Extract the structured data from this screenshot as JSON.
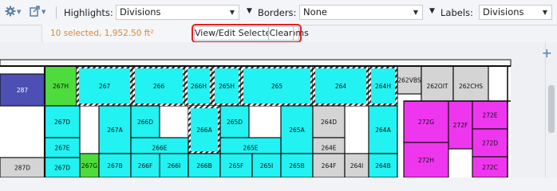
{
  "toolbar": {
    "highlights_label": "Highlights:",
    "highlights_value": "Divisions",
    "borders_label": "Borders:",
    "borders_value": "None",
    "labels_label": "Labels:",
    "labels_value": "Divisions"
  },
  "selection": {
    "count_text": "10 selected, 1,952.50 ft²",
    "view_edit_label": "View/Edit Selected Rooms",
    "clear_label": "Clear"
  },
  "colors": {
    "cyan": "#22f2f2",
    "green": "#4ddc3c",
    "magenta": "#ef36ef",
    "navy": "#4e4fb5",
    "gray": "#d4d4d4",
    "wall": "#111111"
  },
  "rooms": [
    {
      "label": "287",
      "color": "navy"
    },
    {
      "label": "267H",
      "color": "green"
    },
    {
      "label": "267",
      "color": "cyan",
      "selected": true
    },
    {
      "label": "266",
      "color": "cyan",
      "selected": true
    },
    {
      "label": "266H",
      "color": "cyan",
      "selected": true
    },
    {
      "label": "265H",
      "color": "cyan",
      "selected": true
    },
    {
      "label": "265",
      "color": "cyan",
      "selected": true
    },
    {
      "label": "264",
      "color": "cyan",
      "selected": true
    },
    {
      "label": "264H",
      "color": "cyan",
      "selected": true
    },
    {
      "label": "262VBS",
      "color": "gray"
    },
    {
      "label": "262OIT",
      "color": "gray"
    },
    {
      "label": "262CHS",
      "color": "gray"
    },
    {
      "label": "267D",
      "color": "cyan"
    },
    {
      "label": "267A",
      "color": "cyan"
    },
    {
      "label": "266D",
      "color": "cyan"
    },
    {
      "label": "266A",
      "color": "cyan",
      "selected": true
    },
    {
      "label": "265D",
      "color": "cyan"
    },
    {
      "label": "265A",
      "color": "cyan"
    },
    {
      "label": "264D",
      "color": "gray"
    },
    {
      "label": "264A",
      "color": "cyan"
    },
    {
      "label": "272G",
      "color": "magenta"
    },
    {
      "label": "272F",
      "color": "magenta"
    },
    {
      "label": "272E",
      "color": "magenta"
    },
    {
      "label": "267E",
      "color": "cyan"
    },
    {
      "label": "266E",
      "color": "cyan"
    },
    {
      "label": "265E",
      "color": "cyan"
    },
    {
      "label": "264E",
      "color": "gray"
    },
    {
      "label": "272D",
      "color": "magenta"
    },
    {
      "label": "267G",
      "color": "green"
    },
    {
      "label": "267B",
      "color": "cyan"
    },
    {
      "label": "266F",
      "color": "cyan"
    },
    {
      "label": "266I",
      "color": "cyan"
    },
    {
      "label": "266B",
      "color": "cyan"
    },
    {
      "label": "265F",
      "color": "cyan"
    },
    {
      "label": "265I",
      "color": "cyan"
    },
    {
      "label": "265B",
      "color": "cyan"
    },
    {
      "label": "264F",
      "color": "gray"
    },
    {
      "label": "264I",
      "color": "gray"
    },
    {
      "label": "264B",
      "color": "cyan"
    },
    {
      "label": "272H",
      "color": "magenta"
    },
    {
      "label": "272C",
      "color": "magenta"
    },
    {
      "label": "267D",
      "color": "cyan"
    },
    {
      "label": "287D",
      "color": "gray"
    }
  ]
}
